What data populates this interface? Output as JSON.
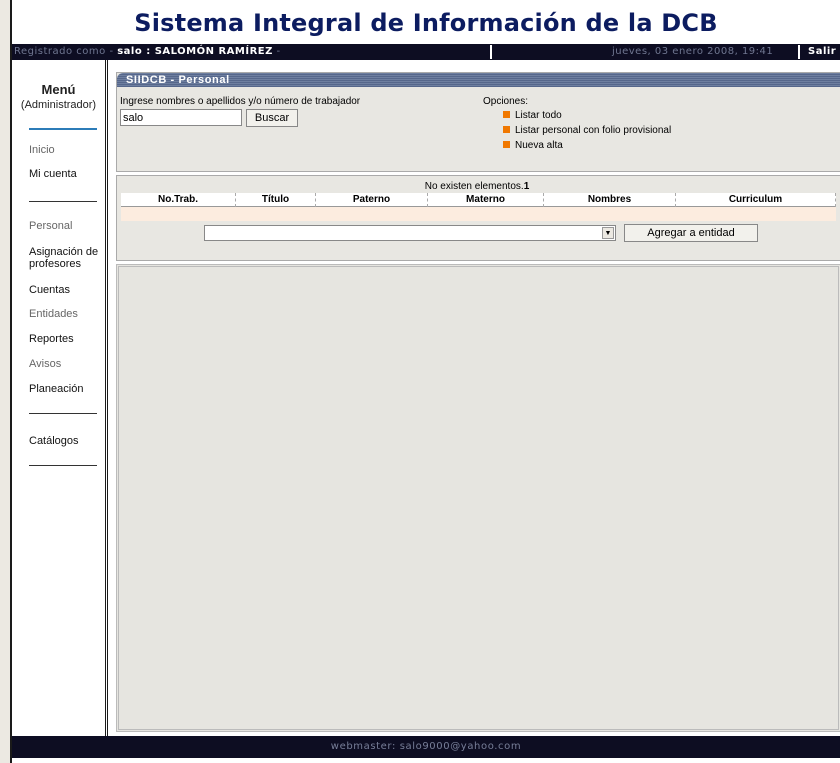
{
  "header": {
    "title": "Sistema Integral de Información de la DCB"
  },
  "topbar": {
    "registered_as": "Registrado como - ",
    "user": "salo : SALOMÓN RAMÍREZ",
    "trail": " -",
    "date": "jueves, 03 enero 2008, 19:41",
    "logout": "Salir"
  },
  "sidebar": {
    "title": "Menú",
    "role": "(Administrador)",
    "items": [
      {
        "label": "Inicio"
      },
      {
        "label": "Mi cuenta"
      },
      {
        "label": "Personal"
      },
      {
        "label": "Asignación de profesores"
      },
      {
        "label": "Cuentas"
      },
      {
        "label": "Entidades"
      },
      {
        "label": "Reportes"
      },
      {
        "label": "Avisos"
      },
      {
        "label": "Planeación"
      },
      {
        "label": "Catálogos"
      }
    ]
  },
  "personal_panel": {
    "title": "SIIDCB - Personal",
    "search_label": "Ingrese nombres o apellidos y/o número de trabajador",
    "search_value": "salo",
    "search_button": "Buscar",
    "options_label": "Opciones:",
    "options": [
      {
        "label": "Listar todo"
      },
      {
        "label": "Listar personal con folio provisional"
      },
      {
        "label": "Nueva alta"
      }
    ],
    "option_color": "#f07800"
  },
  "results": {
    "message": "No existen elementos.",
    "count": "1",
    "columns": [
      "No.Trab.",
      "Título",
      "Paterno",
      "Materno",
      "Nombres",
      "Curriculum"
    ],
    "entity_select_value": "",
    "add_button": "Agregar a entidad"
  },
  "footer": {
    "text": "webmaster: salo9000@yahoo.com"
  },
  "colors": {
    "title": "#0c1c60",
    "bar": "#0d0d22",
    "accent": "#2c7cb8",
    "row": "#fcecdf"
  }
}
